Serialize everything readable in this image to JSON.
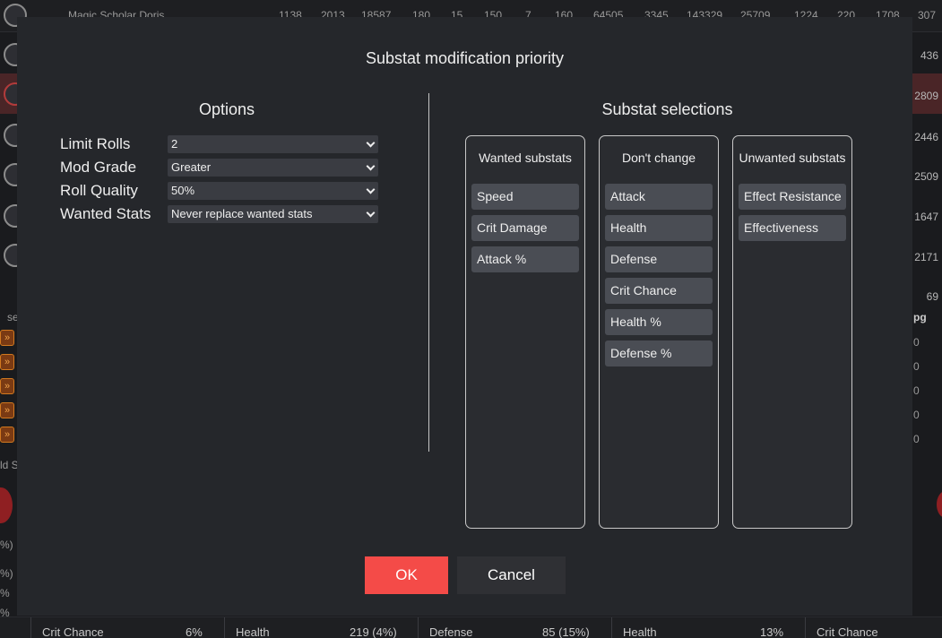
{
  "background": {
    "top_row": {
      "hero_name": "Magic Scholar Doris",
      "values": [
        "1138",
        "2013",
        "18587",
        "180",
        "15",
        "150",
        "7",
        "160",
        "64505",
        "3345",
        "143329",
        "25709",
        "1224",
        "220",
        "1708",
        "307"
      ]
    },
    "right_column_values": [
      "436",
      "2809",
      "2446",
      "2509",
      "1647",
      "2171",
      "69"
    ],
    "side_fragments": [
      "se",
      "pg",
      "ld S",
      "%)",
      "%)",
      "%",
      "%"
    ],
    "zero_values": [
      "0",
      "0",
      "0",
      "0",
      "0"
    ],
    "bottom_stats": [
      {
        "label": "Crit Chance",
        "value": "6%"
      },
      {
        "label": "Health",
        "value": "219 (4%)"
      },
      {
        "label": "Defense",
        "value": "85 (15%)"
      },
      {
        "label": "Health",
        "value": "13%"
      },
      {
        "label": "Crit Chance",
        "value": ""
      }
    ]
  },
  "modal": {
    "title": "Substat modification priority",
    "options": {
      "title": "Options",
      "rows": [
        {
          "label": "Limit Rolls",
          "value": "2"
        },
        {
          "label": "Mod Grade",
          "value": "Greater"
        },
        {
          "label": "Roll Quality",
          "value": "50%"
        },
        {
          "label": "Wanted Stats",
          "value": "Never replace wanted stats"
        }
      ]
    },
    "selections": {
      "title": "Substat selections",
      "columns": [
        {
          "title": "Wanted substats",
          "items": [
            "Speed",
            "Crit Damage",
            "Attack %"
          ]
        },
        {
          "title": "Don't change",
          "items": [
            "Attack",
            "Health",
            "Defense",
            "Crit Chance",
            "Health %",
            "Defense %"
          ]
        },
        {
          "title": "Unwanted substats",
          "items": [
            "Effect Resistance",
            "Effectiveness"
          ]
        }
      ]
    },
    "ok_label": "OK",
    "cancel_label": "Cancel"
  },
  "colors": {
    "accent": "#f44b48",
    "modal_bg": "#25272b",
    "chip_bg": "#4a4d54"
  }
}
